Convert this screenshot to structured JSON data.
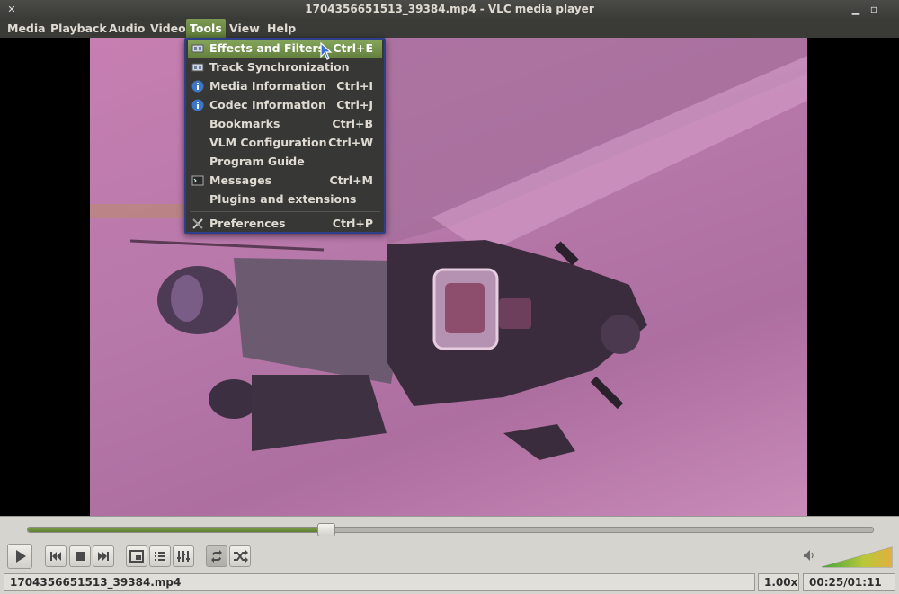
{
  "window": {
    "title": "1704356651513_39384.mp4 - VLC media player"
  },
  "menubar": {
    "items": [
      {
        "label": "Media"
      },
      {
        "label": "Playback"
      },
      {
        "label": "Audio"
      },
      {
        "label": "Video"
      },
      {
        "label": "Tools"
      },
      {
        "label": "View"
      },
      {
        "label": "Help"
      }
    ],
    "active": "Tools"
  },
  "tools_menu": {
    "items": [
      {
        "label": "Effects and Filters",
        "shortcut": "Ctrl+E",
        "icon": "effects-icon"
      },
      {
        "label": "Track Synchronization",
        "shortcut": "",
        "icon": "sync-icon"
      },
      {
        "label": "Media Information",
        "shortcut": "Ctrl+I",
        "icon": "info-icon"
      },
      {
        "label": "Codec Information",
        "shortcut": "Ctrl+J",
        "icon": "info-icon"
      },
      {
        "label": "Bookmarks",
        "shortcut": "Ctrl+B",
        "icon": ""
      },
      {
        "label": "VLM Configuration",
        "shortcut": "Ctrl+W",
        "icon": ""
      },
      {
        "label": "Program Guide",
        "shortcut": "",
        "icon": ""
      },
      {
        "label": "Messages",
        "shortcut": "Ctrl+M",
        "icon": "terminal-icon"
      },
      {
        "label": "Plugins and extensions",
        "shortcut": "",
        "icon": ""
      },
      {
        "label": "Preferences",
        "shortcut": "Ctrl+P",
        "icon": "tools-icon"
      }
    ],
    "highlighted": "Effects and Filters"
  },
  "player": {
    "progress_fraction": 0.352,
    "volume_fraction": 1.0,
    "accent_color": "#6a8a3c"
  },
  "statusbar": {
    "filename": "1704356651513_39384.mp4",
    "speed": "1.00x",
    "time": "00:25/01:11"
  }
}
